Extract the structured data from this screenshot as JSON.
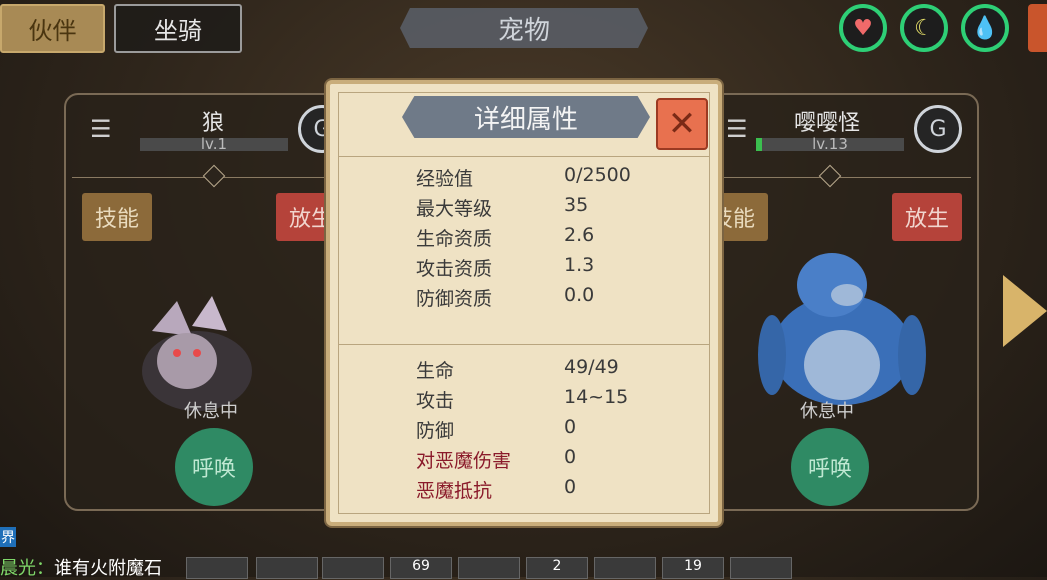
{
  "top_tabs": {
    "partner": "伙伴",
    "mount": "坐骑"
  },
  "title": "宠物",
  "status_icons": [
    "heart-icon",
    "banana-icon",
    "water-drop-icon"
  ],
  "cards": [
    {
      "name": "狼",
      "level": "lv.1",
      "level_fill": 0.0,
      "skill": "技能",
      "release": "放生",
      "status": "休息中",
      "summon": "呼唤"
    },
    {
      "name": "嘤嘤怪",
      "level": "lv.13",
      "level_fill": 0.04,
      "skill": "技能",
      "release": "放生",
      "status": "休息中",
      "summon": "呼唤"
    }
  ],
  "modal": {
    "title": "详细属性",
    "group1": [
      {
        "label": "经验值",
        "value": "0/2500"
      },
      {
        "label": "最大等级",
        "value": "35"
      },
      {
        "label": "生命资质",
        "value": "2.6"
      },
      {
        "label": "攻击资质",
        "value": "1.3"
      },
      {
        "label": "防御资质",
        "value": "0.0"
      }
    ],
    "group2": [
      {
        "label": "生命",
        "value": "49/49"
      },
      {
        "label": "攻击",
        "value": "14~15"
      },
      {
        "label": "防御",
        "value": "0"
      },
      {
        "label": "对恶魔伤害",
        "value": "0"
      },
      {
        "label": "恶魔抵抗",
        "value": "0"
      }
    ]
  },
  "chat": {
    "tag": "界",
    "speaker": "晨光：",
    "message": "谁有火附魔石"
  },
  "hotbar_counts": [
    "69",
    "2",
    "19"
  ]
}
